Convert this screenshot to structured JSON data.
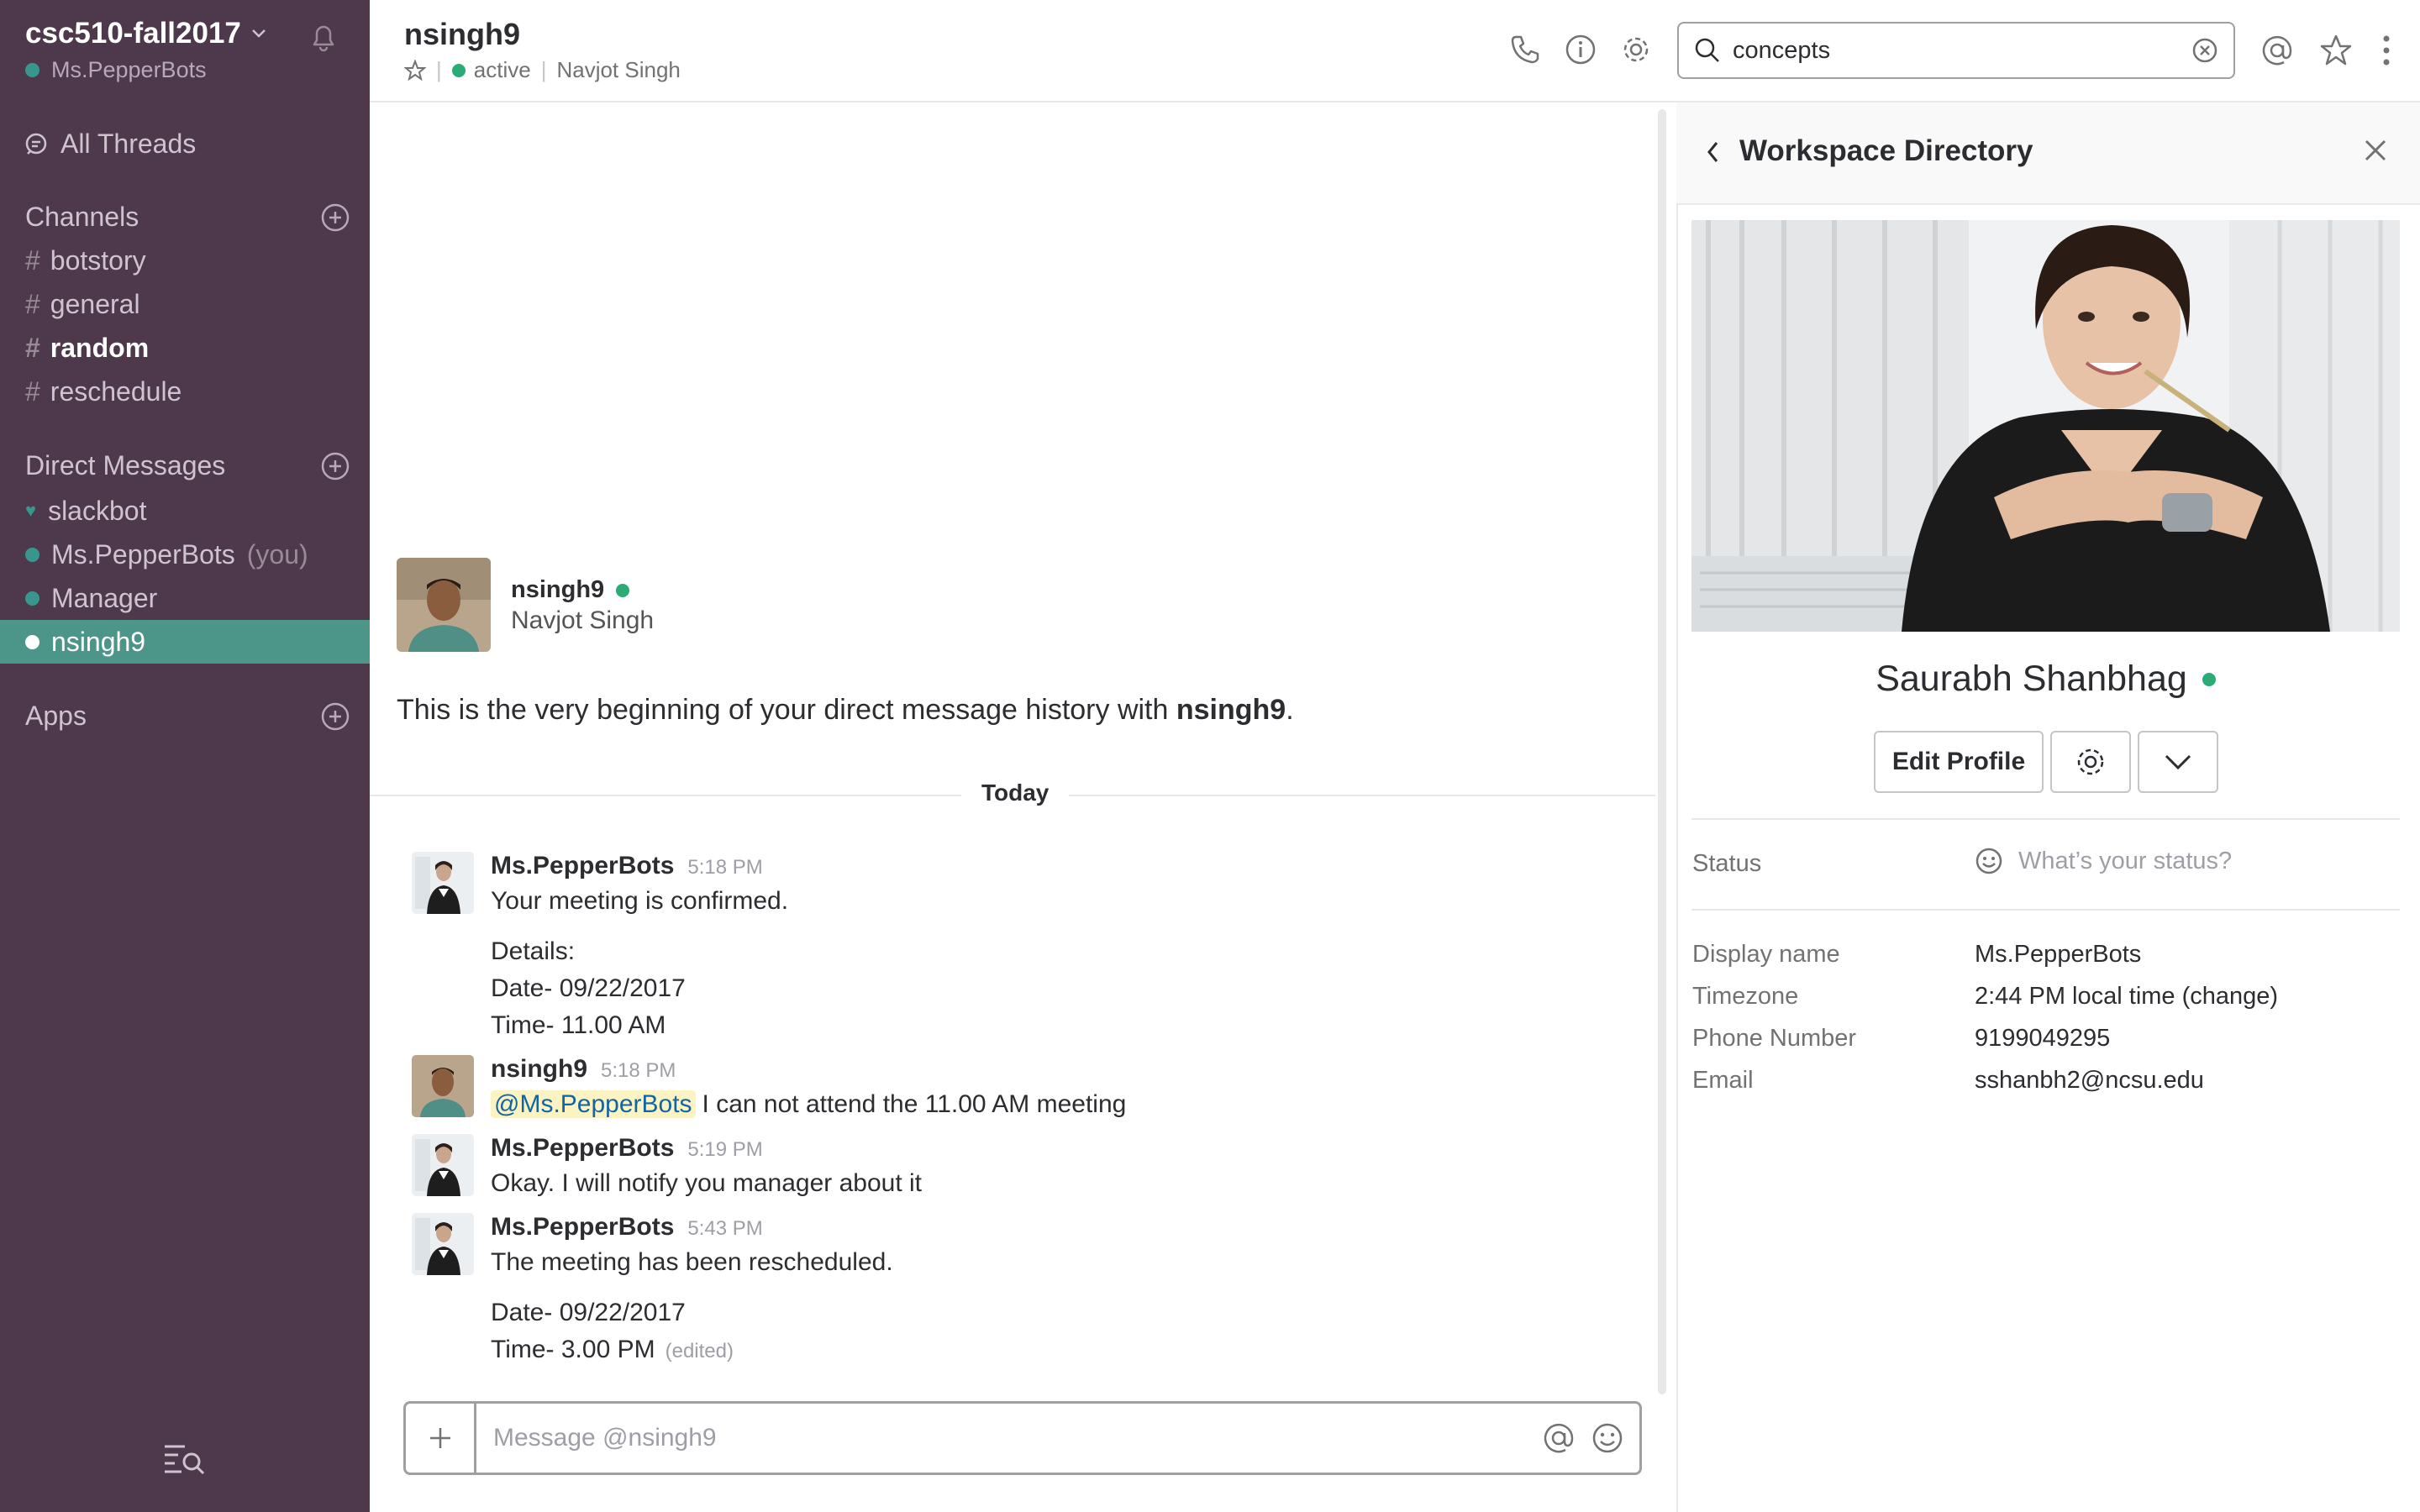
{
  "sidebar": {
    "team_name": "csc510-fall2017",
    "current_user": "Ms.PepperBots",
    "all_threads": "All Threads",
    "channels_heading": "Channels",
    "channels": [
      {
        "name": "botstory"
      },
      {
        "name": "general"
      },
      {
        "name": "random"
      },
      {
        "name": "reschedule"
      }
    ],
    "dm_heading": "Direct Messages",
    "dms": [
      {
        "name": "slackbot"
      },
      {
        "name": "Ms.PepperBots",
        "suffix": "(you)"
      },
      {
        "name": "Manager"
      },
      {
        "name": "nsingh9"
      }
    ],
    "apps_heading": "Apps"
  },
  "header": {
    "channel_name": "nsingh9",
    "presence": "active",
    "real_name": "Navjot Singh",
    "search_value": "concepts"
  },
  "intro": {
    "username": "nsingh9",
    "real_name": "Navjot Singh",
    "text_before": "This is the very beginning of your direct message history with",
    "text_name": "nsingh9",
    "text_after": "."
  },
  "divider": "Today",
  "messages": [
    {
      "author": "Ms.PepperBots",
      "time": "5:18 PM",
      "lines": [
        "Your meeting is confirmed.",
        "Details:",
        "Date- 09/22/2017",
        "Time- 11.00 AM"
      ]
    },
    {
      "author": "nsingh9",
      "time": "5:18 PM",
      "mention": "@Ms.PepperBots",
      "text": "I can not attend the 11.00 AM meeting"
    },
    {
      "author": "Ms.PepperBots",
      "time": "5:19 PM",
      "text": "Okay. I will notify you manager about it"
    },
    {
      "author": "Ms.PepperBots",
      "time": "5:43 PM",
      "lines": [
        "The meeting has been rescheduled.",
        "Date- 09/22/2017",
        "Time- 3.00 PM"
      ],
      "edited": "(edited)"
    }
  ],
  "composer": {
    "placeholder": "Message @nsingh9"
  },
  "panel": {
    "title": "Workspace Directory",
    "name": "Saurabh Shanbhag",
    "edit_profile": "Edit Profile",
    "status_label": "Status",
    "status_placeholder": "What’s your status?",
    "fields": [
      {
        "label": "Display name",
        "value": "Ms.PepperBots"
      },
      {
        "label": "Timezone",
        "value": "2:44 PM local time (change)"
      },
      {
        "label": "Phone Number",
        "value": "9199049295"
      },
      {
        "label": "Email",
        "value": "sshanbh2@ncsu.edu"
      }
    ]
  },
  "colors": {
    "sidebar_bg": "#4d394b",
    "active_item_bg": "#4c9689",
    "presence_green": "#2bac76",
    "mention_bg": "#fbf3c2"
  }
}
